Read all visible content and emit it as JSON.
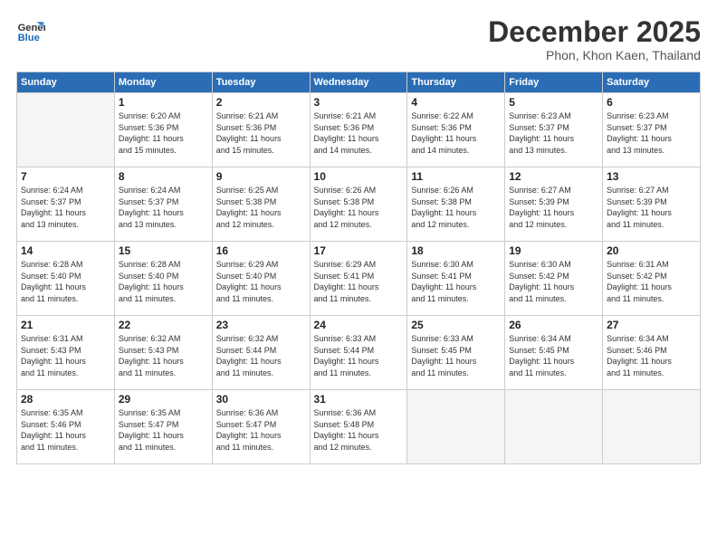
{
  "header": {
    "logo_line1": "General",
    "logo_line2": "Blue",
    "month": "December 2025",
    "location": "Phon, Khon Kaen, Thailand"
  },
  "weekdays": [
    "Sunday",
    "Monday",
    "Tuesday",
    "Wednesday",
    "Thursday",
    "Friday",
    "Saturday"
  ],
  "weeks": [
    [
      {
        "day": "",
        "info": ""
      },
      {
        "day": "1",
        "info": "Sunrise: 6:20 AM\nSunset: 5:36 PM\nDaylight: 11 hours\nand 15 minutes."
      },
      {
        "day": "2",
        "info": "Sunrise: 6:21 AM\nSunset: 5:36 PM\nDaylight: 11 hours\nand 15 minutes."
      },
      {
        "day": "3",
        "info": "Sunrise: 6:21 AM\nSunset: 5:36 PM\nDaylight: 11 hours\nand 14 minutes."
      },
      {
        "day": "4",
        "info": "Sunrise: 6:22 AM\nSunset: 5:36 PM\nDaylight: 11 hours\nand 14 minutes."
      },
      {
        "day": "5",
        "info": "Sunrise: 6:23 AM\nSunset: 5:37 PM\nDaylight: 11 hours\nand 13 minutes."
      },
      {
        "day": "6",
        "info": "Sunrise: 6:23 AM\nSunset: 5:37 PM\nDaylight: 11 hours\nand 13 minutes."
      }
    ],
    [
      {
        "day": "7",
        "info": "Sunrise: 6:24 AM\nSunset: 5:37 PM\nDaylight: 11 hours\nand 13 minutes."
      },
      {
        "day": "8",
        "info": "Sunrise: 6:24 AM\nSunset: 5:37 PM\nDaylight: 11 hours\nand 13 minutes."
      },
      {
        "day": "9",
        "info": "Sunrise: 6:25 AM\nSunset: 5:38 PM\nDaylight: 11 hours\nand 12 minutes."
      },
      {
        "day": "10",
        "info": "Sunrise: 6:26 AM\nSunset: 5:38 PM\nDaylight: 11 hours\nand 12 minutes."
      },
      {
        "day": "11",
        "info": "Sunrise: 6:26 AM\nSunset: 5:38 PM\nDaylight: 11 hours\nand 12 minutes."
      },
      {
        "day": "12",
        "info": "Sunrise: 6:27 AM\nSunset: 5:39 PM\nDaylight: 11 hours\nand 12 minutes."
      },
      {
        "day": "13",
        "info": "Sunrise: 6:27 AM\nSunset: 5:39 PM\nDaylight: 11 hours\nand 11 minutes."
      }
    ],
    [
      {
        "day": "14",
        "info": "Sunrise: 6:28 AM\nSunset: 5:40 PM\nDaylight: 11 hours\nand 11 minutes."
      },
      {
        "day": "15",
        "info": "Sunrise: 6:28 AM\nSunset: 5:40 PM\nDaylight: 11 hours\nand 11 minutes."
      },
      {
        "day": "16",
        "info": "Sunrise: 6:29 AM\nSunset: 5:40 PM\nDaylight: 11 hours\nand 11 minutes."
      },
      {
        "day": "17",
        "info": "Sunrise: 6:29 AM\nSunset: 5:41 PM\nDaylight: 11 hours\nand 11 minutes."
      },
      {
        "day": "18",
        "info": "Sunrise: 6:30 AM\nSunset: 5:41 PM\nDaylight: 11 hours\nand 11 minutes."
      },
      {
        "day": "19",
        "info": "Sunrise: 6:30 AM\nSunset: 5:42 PM\nDaylight: 11 hours\nand 11 minutes."
      },
      {
        "day": "20",
        "info": "Sunrise: 6:31 AM\nSunset: 5:42 PM\nDaylight: 11 hours\nand 11 minutes."
      }
    ],
    [
      {
        "day": "21",
        "info": "Sunrise: 6:31 AM\nSunset: 5:43 PM\nDaylight: 11 hours\nand 11 minutes."
      },
      {
        "day": "22",
        "info": "Sunrise: 6:32 AM\nSunset: 5:43 PM\nDaylight: 11 hours\nand 11 minutes."
      },
      {
        "day": "23",
        "info": "Sunrise: 6:32 AM\nSunset: 5:44 PM\nDaylight: 11 hours\nand 11 minutes."
      },
      {
        "day": "24",
        "info": "Sunrise: 6:33 AM\nSunset: 5:44 PM\nDaylight: 11 hours\nand 11 minutes."
      },
      {
        "day": "25",
        "info": "Sunrise: 6:33 AM\nSunset: 5:45 PM\nDaylight: 11 hours\nand 11 minutes."
      },
      {
        "day": "26",
        "info": "Sunrise: 6:34 AM\nSunset: 5:45 PM\nDaylight: 11 hours\nand 11 minutes."
      },
      {
        "day": "27",
        "info": "Sunrise: 6:34 AM\nSunset: 5:46 PM\nDaylight: 11 hours\nand 11 minutes."
      }
    ],
    [
      {
        "day": "28",
        "info": "Sunrise: 6:35 AM\nSunset: 5:46 PM\nDaylight: 11 hours\nand 11 minutes."
      },
      {
        "day": "29",
        "info": "Sunrise: 6:35 AM\nSunset: 5:47 PM\nDaylight: 11 hours\nand 11 minutes."
      },
      {
        "day": "30",
        "info": "Sunrise: 6:36 AM\nSunset: 5:47 PM\nDaylight: 11 hours\nand 11 minutes."
      },
      {
        "day": "31",
        "info": "Sunrise: 6:36 AM\nSunset: 5:48 PM\nDaylight: 11 hours\nand 12 minutes."
      },
      {
        "day": "",
        "info": ""
      },
      {
        "day": "",
        "info": ""
      },
      {
        "day": "",
        "info": ""
      }
    ]
  ]
}
